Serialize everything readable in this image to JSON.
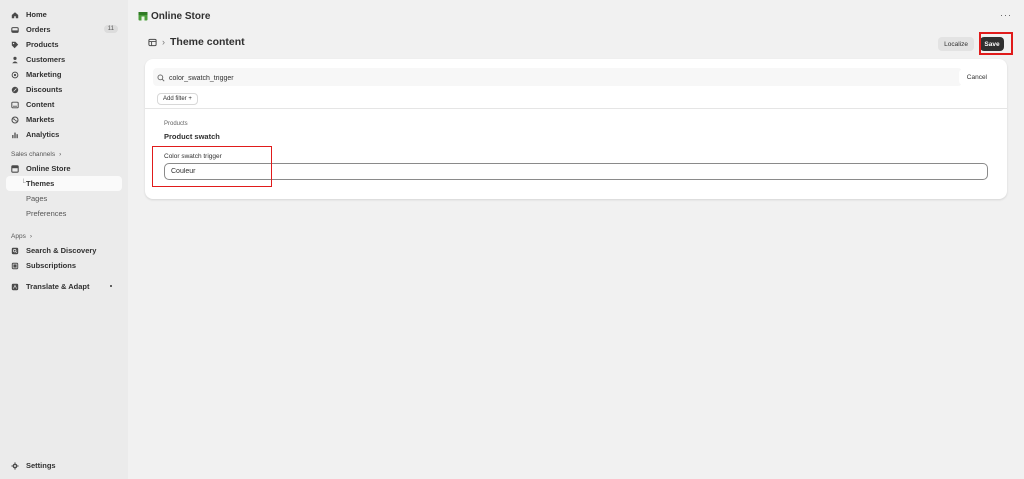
{
  "sidebar": {
    "items": [
      {
        "label": "Home",
        "icon": "home-icon"
      },
      {
        "label": "Orders",
        "icon": "orders-icon",
        "badge": "11"
      },
      {
        "label": "Products",
        "icon": "tag-icon"
      },
      {
        "label": "Customers",
        "icon": "person-icon"
      },
      {
        "label": "Marketing",
        "icon": "target-icon"
      },
      {
        "label": "Discounts",
        "icon": "discount-icon"
      },
      {
        "label": "Content",
        "icon": "content-icon"
      },
      {
        "label": "Markets",
        "icon": "globe-icon"
      },
      {
        "label": "Analytics",
        "icon": "analytics-icon"
      }
    ],
    "sales_channels_label": "Sales channels",
    "online_store_label": "Online Store",
    "sub_items": [
      "Themes",
      "Pages",
      "Preferences"
    ],
    "apps_label": "Apps",
    "apps": [
      "Search & Discovery",
      "Subscriptions"
    ],
    "translate_label": "Translate & Adapt",
    "settings_label": "Settings"
  },
  "topbar": {
    "store_title": "Online Store",
    "more": "···"
  },
  "header": {
    "title": "Theme content",
    "localize_label": "Localize",
    "save_label": "Save"
  },
  "search": {
    "value": "color_swatch_trigger",
    "cancel_label": "Cancel",
    "add_filter_label": "Add filter +"
  },
  "content": {
    "crumb": "Products",
    "section_title": "Product swatch",
    "field_label": "Color swatch trigger",
    "field_value": "Couleur"
  },
  "colors": {
    "highlight": "#e01b1b",
    "save_bg": "#303030",
    "brand_green": "#4a9d3a"
  }
}
